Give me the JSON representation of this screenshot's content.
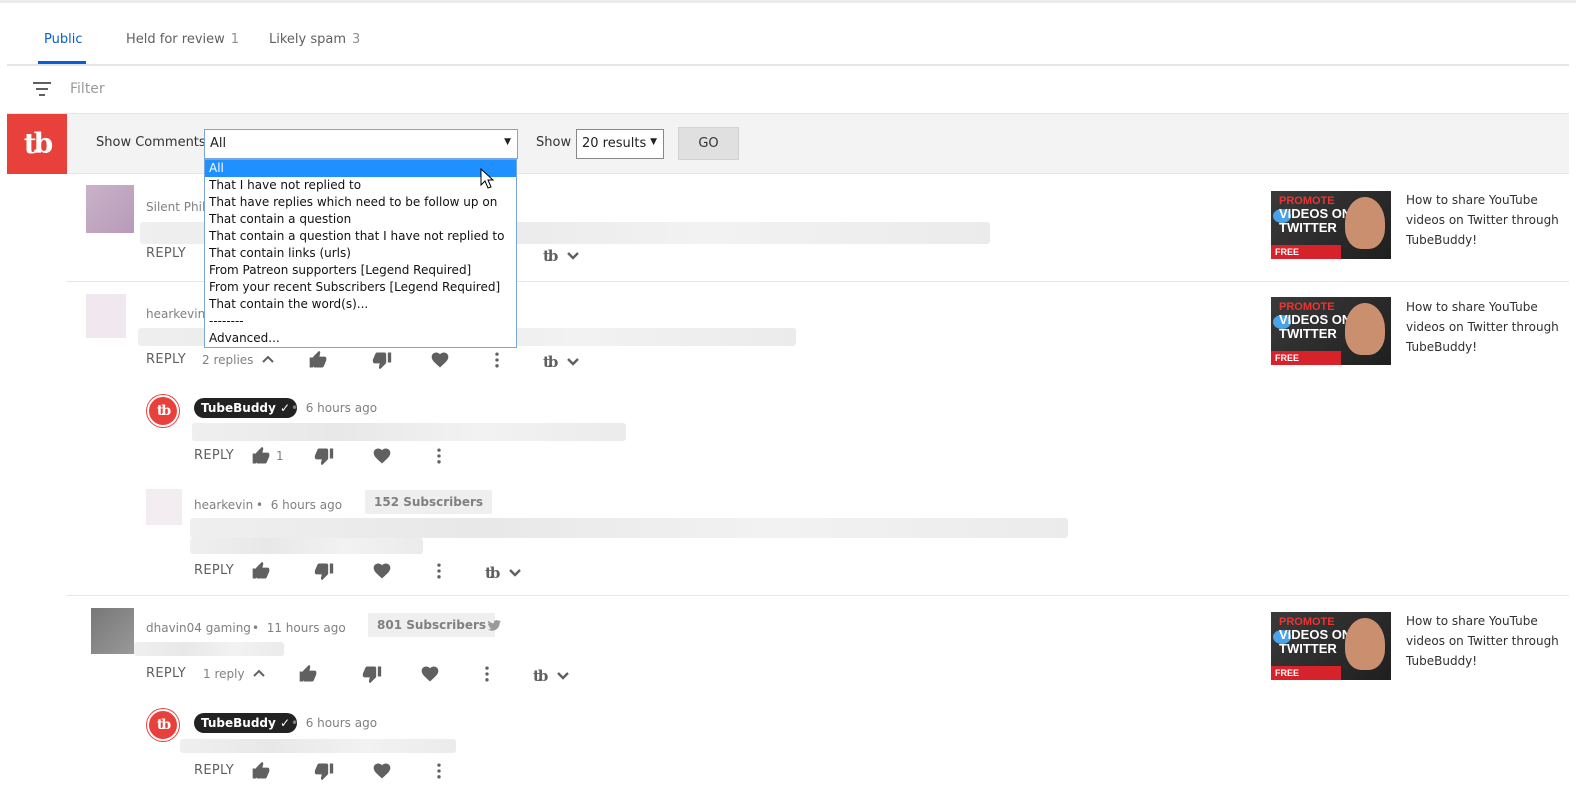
{
  "tabs": [
    {
      "label": "Public",
      "count": ""
    },
    {
      "label": "Held for review",
      "count": "1"
    },
    {
      "label": "Likely spam",
      "count": "3"
    }
  ],
  "filter": {
    "placeholder": "Filter"
  },
  "toolbar": {
    "show_comments_label": "Show Comments",
    "selected": "All",
    "show_label": "Show",
    "results_value": "20 results",
    "go_label": "GO"
  },
  "dropdown_options": [
    "All",
    "That I have not replied to",
    "That have replies which need to be follow up on",
    "That contain a question",
    "That contain a question that I have not replied to",
    "That contain links (urls)",
    "From Patreon supporters [Legend Required]",
    "From your recent Subscribers [Legend Required]",
    "That contain the word(s)...",
    "--------",
    "Advanced..."
  ],
  "comments": [
    {
      "author": "Silent Phil",
      "reply": "REPLY",
      "video": {
        "badge": "PROMOTE",
        "title_lines": "VIDEOS ON TWITTER",
        "feature": "FREE FEATURE",
        "title": "How to share YouTube videos on Twitter through TubeBuddy!"
      }
    },
    {
      "author": "hearkevin",
      "reply": "REPLY",
      "replies": "2 replies",
      "video": {
        "badge": "PROMOTE",
        "title_lines": "VIDEOS ON TWITTER",
        "feature": "FREE FEATURE",
        "title": "How to share YouTube videos on Twitter through TubeBuddy!"
      }
    },
    {
      "author": "dhavin04 gaming",
      "time": "11 hours ago",
      "subscribers": "801 Subscribers",
      "reply": "REPLY",
      "replies": "1 reply",
      "video": {
        "badge": "PROMOTE",
        "title_lines": "VIDEOS ON TWITTER",
        "feature": "FREE FEATURE",
        "title": "How to share YouTube videos on Twitter through TubeBuddy!"
      }
    }
  ],
  "replies": [
    {
      "author": "TubeBuddy",
      "time": "6 hours ago",
      "reply": "REPLY",
      "likes": "1"
    },
    {
      "author": "hearkevin",
      "time": "6 hours ago",
      "subscribers": "152 Subscribers",
      "reply": "REPLY"
    },
    {
      "author": "TubeBuddy",
      "time": "6 hours ago",
      "reply": "REPLY"
    }
  ],
  "icons": {
    "logo": "tb",
    "dot": "•",
    "check": "✓"
  },
  "colors": {
    "accent": "#065fd4",
    "brand": "#e8413b",
    "selection": "#1e90ff"
  }
}
